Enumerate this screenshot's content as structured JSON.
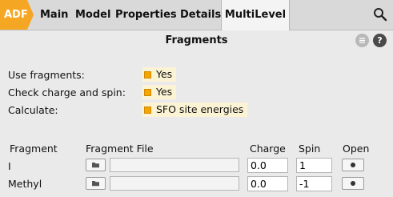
{
  "tabs": {
    "adf": "ADF",
    "items": [
      "Main",
      "Model",
      "Properties",
      "Details",
      "MultiLevel"
    ],
    "active": "MultiLevel"
  },
  "header": {
    "title": "Fragments",
    "menu_icon": "menu-icon",
    "help_icon": "help-icon",
    "help_glyph": "?"
  },
  "options": [
    {
      "label": "Use fragments:",
      "value": "Yes"
    },
    {
      "label": "Check charge and spin:",
      "value": "Yes"
    },
    {
      "label": "Calculate:",
      "value": "SFO site energies"
    }
  ],
  "table": {
    "headers": {
      "fragment": "Fragment",
      "file": "Fragment File",
      "charge": "Charge",
      "spin": "Spin",
      "open": "Open"
    },
    "rows": [
      {
        "name": "I",
        "file": "",
        "charge": "0.0",
        "spin": "1"
      },
      {
        "name": "Methyl",
        "file": "",
        "charge": "0.0",
        "spin": "-1"
      }
    ]
  },
  "colors": {
    "accent": "#f5a623",
    "highlight": "#fcf3d5",
    "background": "#eaeaea"
  }
}
